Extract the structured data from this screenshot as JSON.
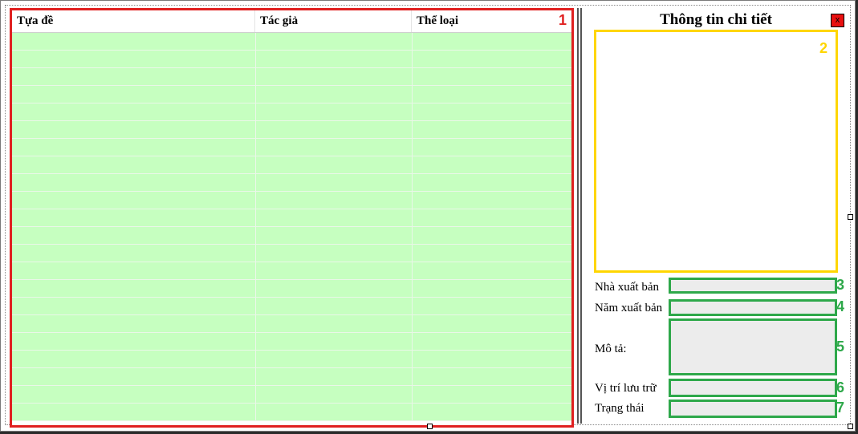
{
  "table": {
    "columns": [
      "Tựa đề",
      "Tác giả",
      "Thể loại"
    ],
    "row_count": 22,
    "marker": "1"
  },
  "detail": {
    "title": "Thông tin chi tiết",
    "close_label": "x",
    "image_marker": "2",
    "fields": [
      {
        "label": "Nhà xuất bản",
        "marker": "3"
      },
      {
        "label": "Năm xuất bản",
        "marker": "4"
      },
      {
        "label": "Mô tả:",
        "marker": "5"
      },
      {
        "label": "Vị trí lưu trữ",
        "marker": "6"
      },
      {
        "label": "Trạng thái",
        "marker": "7"
      }
    ]
  },
  "colors": {
    "table_border": "#e02020",
    "row_fill": "#c6ffc0",
    "image_border": "#ffd600",
    "field_border": "#2ea84a",
    "close_button": "#e81010"
  }
}
